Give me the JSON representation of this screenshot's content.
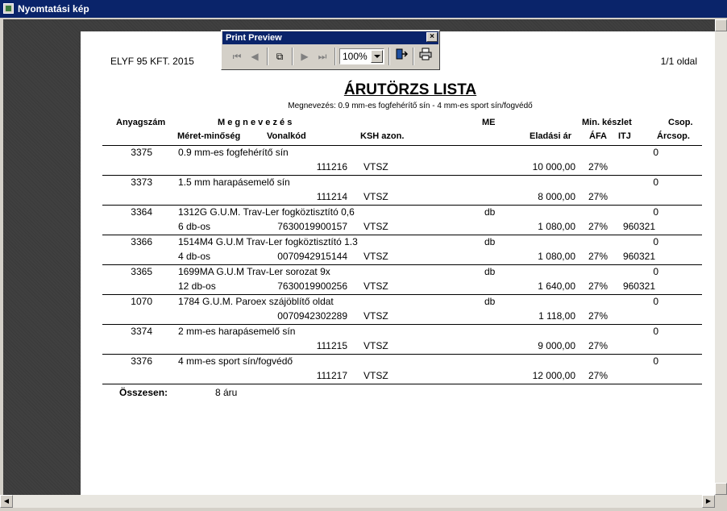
{
  "window": {
    "title": "Nyomtatási kép"
  },
  "print_preview": {
    "title": "Print Preview",
    "close": "×",
    "zoom": "100%",
    "icons": [
      "first-page-icon",
      "prev-page-icon",
      "copy-icon",
      "next-page-icon",
      "last-page-icon",
      "exit-icon",
      "printer-icon"
    ]
  },
  "report": {
    "company": "ELYF 95 KFT. 2015",
    "page": "1/1 oldal",
    "title": "ÁRUTÖRZS LISTA",
    "subtitle": "Megnevezés: 0.9 mm-es fogfehérítő sín - 4 mm-es sport sín/fogvédő",
    "headers": {
      "anyagszam": "Anyagszám",
      "megnevezes": "M e g n e v e z é s",
      "me": "ME",
      "min_keszlet": "Min. készlet",
      "csop": "Csop.",
      "meret": "Méret-minőség",
      "vonalkod": "Vonalkód",
      "ksh": "KSH azon.",
      "eladasi_ar": "Eladási ár",
      "afa": "ÁFA",
      "itj": "ITJ",
      "arcsop": "Árcsop."
    },
    "items": [
      {
        "id": "3375",
        "name": "0.9 mm-es fogfehérítő sín",
        "me": "",
        "min": "0",
        "meret": "",
        "vonalkod": "111216",
        "ksh": "VTSZ",
        "ar": "10 000,00",
        "afa": "27%",
        "itj": ""
      },
      {
        "id": "3373",
        "name": "1.5 mm harapásemelő sín",
        "me": "",
        "min": "0",
        "meret": "",
        "vonalkod": "111214",
        "ksh": "VTSZ",
        "ar": "8 000,00",
        "afa": "27%",
        "itj": ""
      },
      {
        "id": "3364",
        "name": "1312G G.U.M. Trav-Ler fogköztisztító 0,6",
        "me": "db",
        "min": "0",
        "meret": "6 db-os",
        "vonalkod": "7630019900157",
        "ksh": "VTSZ",
        "ar": "1 080,00",
        "afa": "27%",
        "itj": "960321"
      },
      {
        "id": "3366",
        "name": "1514M4 G.U.M Trav-Ler fogköztisztító 1.3",
        "me": "db",
        "min": "0",
        "meret": "4 db-os",
        "vonalkod": "0070942915144",
        "ksh": "VTSZ",
        "ar": "1 080,00",
        "afa": "27%",
        "itj": "960321"
      },
      {
        "id": "3365",
        "name": "1699MA G.U.M Trav-Ler sorozat 9x",
        "me": "db",
        "min": "0",
        "meret": "12 db-os",
        "vonalkod": "7630019900256",
        "ksh": "VTSZ",
        "ar": "1 640,00",
        "afa": "27%",
        "itj": "960321"
      },
      {
        "id": "1070",
        "name": "1784 G.U.M. Paroex szájöblítő oldat",
        "me": "db",
        "min": "0",
        "meret": "",
        "vonalkod": "0070942302289",
        "ksh": "VTSZ",
        "ar": "1 118,00",
        "afa": "27%",
        "itj": ""
      },
      {
        "id": "3374",
        "name": "2 mm-es harapásemelő sín",
        "me": "",
        "min": "0",
        "meret": "",
        "vonalkod": "111215",
        "ksh": "VTSZ",
        "ar": "9 000,00",
        "afa": "27%",
        "itj": ""
      },
      {
        "id": "3376",
        "name": "4 mm-es sport sín/fogvédő",
        "me": "",
        "min": "0",
        "meret": "",
        "vonalkod": "111217",
        "ksh": "VTSZ",
        "ar": "12 000,00",
        "afa": "27%",
        "itj": ""
      }
    ],
    "total_label": "Összesen:",
    "total_value": "8 áru"
  }
}
